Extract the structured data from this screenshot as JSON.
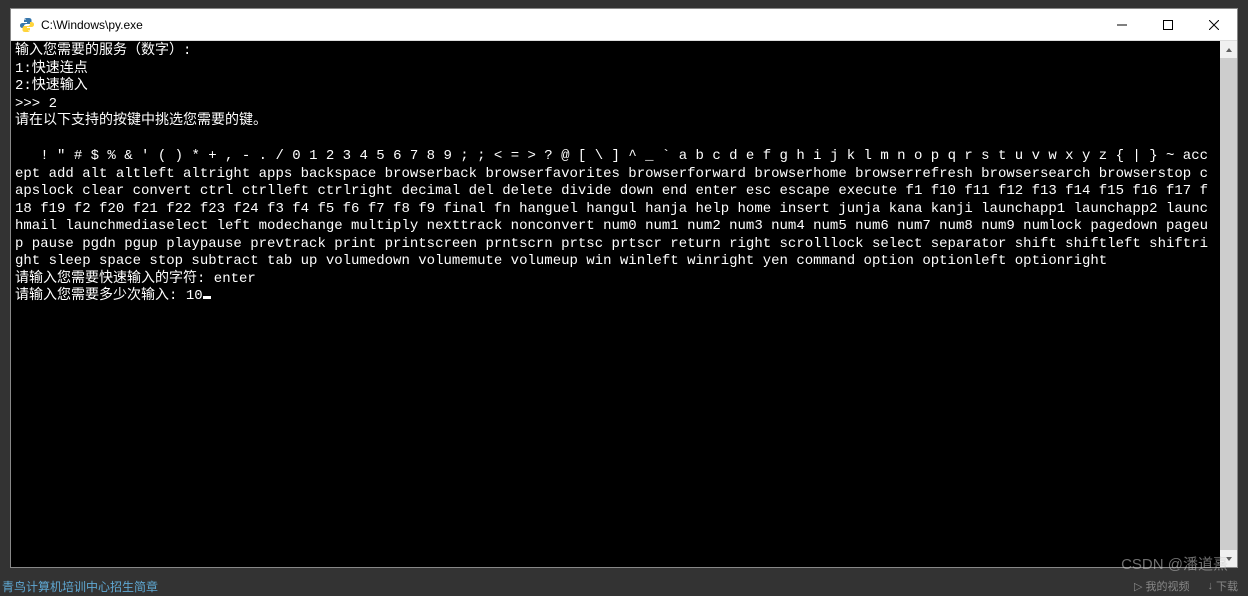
{
  "window": {
    "title": "C:\\Windows\\py.exe"
  },
  "console": {
    "prompt_service": "输入您需要的服务（数字）:",
    "option1": "1:快速连点",
    "option2": "2:快速输入",
    "input_prompt": ">>> 2",
    "keys_intro": "请在以下支持的按键中挑选您需要的键。",
    "keys_block": "   ! \" # $ % & ' ( ) * + , - . / 0 1 2 3 4 5 6 7 8 9 ; ; < = > ? @ [ \\ ] ^ _ ` a b c d e f g h i j k l m n o p q r s t u v w x y z { | } ~ accept add alt altleft altright apps backspace browserback browserfavorites browserforward browserhome browserrefresh browsersearch browserstop capslock clear convert ctrl ctrlleft ctrlright decimal del delete divide down end enter esc escape execute f1 f10 f11 f12 f13 f14 f15 f16 f17 f18 f19 f2 f20 f21 f22 f23 f24 f3 f4 f5 f6 f7 f8 f9 final fn hanguel hangul hanja help home insert junja kana kanji launchapp1 launchapp2 launchmail launchmediaselect left modechange multiply nexttrack nonconvert num0 num1 num2 num3 num4 num5 num6 num7 num8 num9 numlock pagedown pageup pause pgdn pgup playpause prevtrack print printscreen prntscrn prtsc prtscr return right scrolllock select separator shift shiftleft shiftright sleep space stop subtract tab up volumedown volumemute volumeup win winleft winright yen command option optionleft optionright",
    "prompt_char": "请输入您需要快速输入的字符: enter",
    "prompt_count_label": "请输入您需要多少次输入: ",
    "prompt_count_value": "10"
  },
  "watermark": "CSDN @潘道熹",
  "taskbar": {
    "left_text": "青鸟计算机培训中心招生简章",
    "my_video": "我的视频",
    "download": "下载"
  }
}
